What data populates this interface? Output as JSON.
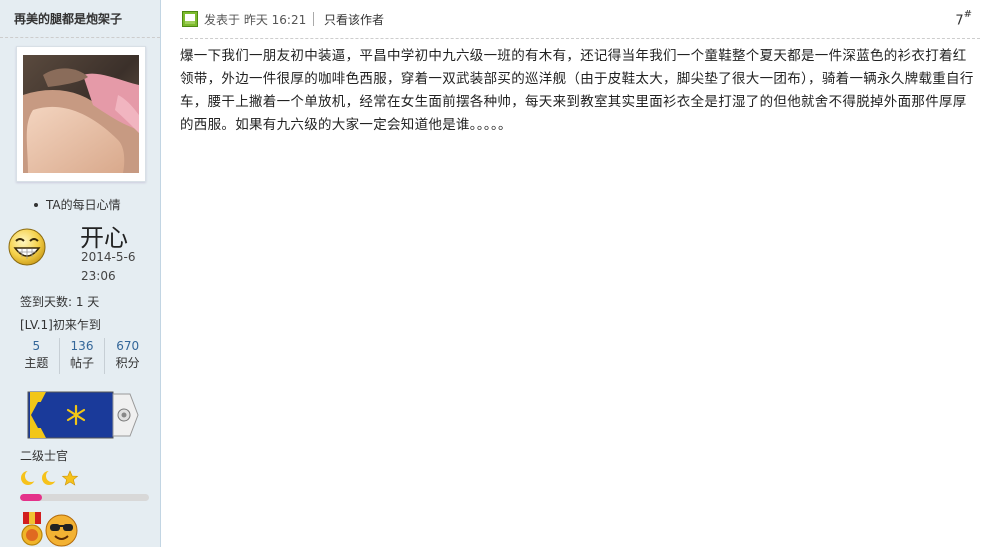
{
  "user": {
    "name": "再美的腿都是炮架子",
    "mood_heading": "TA的每日心情",
    "mood": "开心",
    "mood_date": "2014-5-6",
    "mood_time": "23:06",
    "signin": "签到天数: 1 天",
    "level": "[LV.1]初来乍到",
    "stats": [
      {
        "value": "5",
        "label": "主题"
      },
      {
        "value": "136",
        "label": "帖子"
      },
      {
        "value": "670",
        "label": "积分"
      }
    ],
    "rank": "二级士官",
    "progress_fraction": 0.17
  },
  "post": {
    "posted": "发表于 昨天 16:21",
    "author_only": "只看该作者",
    "floor": "7",
    "floor_mark": "#",
    "content": "爆一下我们一朋友初中装逼，平昌中学初中九六级一班的有木有，还记得当年我们一个童鞋整个夏天都是一件深蓝色的衫衣打着红领带，外边一件很厚的咖啡色西服，穿着一双武装部买的巡洋舰（由于皮鞋太大，脚尖垫了很大一团布），骑着一辆永久牌载重自行车，腰干上撇着一个单放机，经常在女生面前摆各种帅，每天来到教室其实里面衫衣全是打湿了的但他就舍不得脱掉外面那件厚厚的西服。如果有九六级的大家一定会知道他是谁。。。。。"
  },
  "icons": {
    "post": "post-icon",
    "mood": "grin-face-icon",
    "rank": "rank-insignia-icon",
    "medal": "medal-icon",
    "cool": "sunglasses-face-icon"
  },
  "colors": {
    "sidebar_bg": "#e5edf2",
    "link_blue": "#336699",
    "progress_fill": "#e4328a",
    "insignia_blue": "#1a3a9a",
    "insignia_gold": "#f2c617"
  }
}
